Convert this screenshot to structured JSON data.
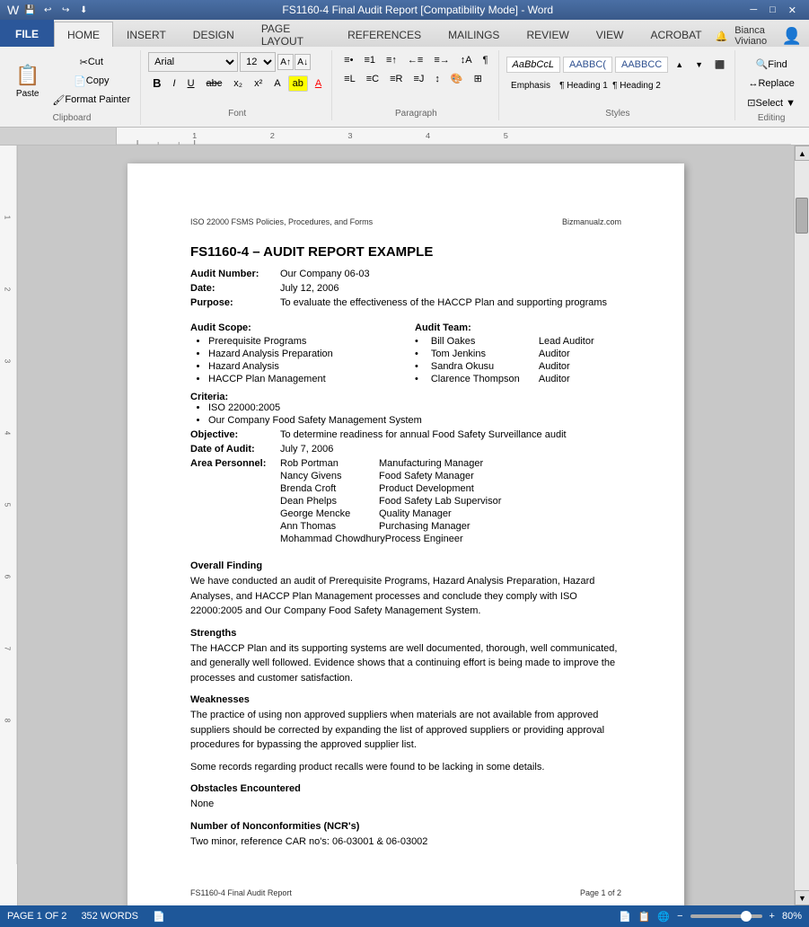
{
  "titleBar": {
    "title": "FS1160-4 Final Audit Report [Compatibility Mode] - Word",
    "minBtn": "─",
    "maxBtn": "□",
    "closeBtn": "✕",
    "quickAccess": [
      "💾",
      "↩",
      "↪",
      "▶",
      "⬇"
    ]
  },
  "ribbon": {
    "tabs": [
      "FILE",
      "HOME",
      "INSERT",
      "DESIGN",
      "PAGE LAYOUT",
      "REFERENCES",
      "MAILINGS",
      "REVIEW",
      "VIEW",
      "ACROBAT"
    ],
    "activeTab": "HOME",
    "fontName": "Arial",
    "fontSize": "12",
    "styles": [
      "Emphasis",
      "¶ Heading 1",
      "¶ Heading 2"
    ],
    "user": "Bianca Viviano",
    "editingGroup": {
      "find": "Find",
      "replace": "Replace",
      "select": "Select ▼"
    }
  },
  "document": {
    "headerLeft": "ISO 22000 FSMS Policies, Procedures, and Forms",
    "headerRight": "Bizmanualz.com",
    "title": "FS1160-4 – AUDIT REPORT EXAMPLE",
    "auditNumber": {
      "label": "Audit Number:",
      "value": "Our Company 06-03"
    },
    "date": {
      "label": "Date:",
      "value": "July 12, 2006"
    },
    "purpose": {
      "label": "Purpose:",
      "value": "To evaluate the effectiveness of the HACCP Plan and supporting programs"
    },
    "auditScope": {
      "label": "Audit Scope:",
      "items": [
        "Prerequisite Programs",
        "Hazard Analysis Preparation",
        "Hazard Analysis",
        "HACCP Plan Management"
      ]
    },
    "auditTeam": {
      "label": "Audit Team:",
      "members": [
        {
          "name": "Bill Oakes",
          "role": "Lead Auditor"
        },
        {
          "name": "Tom Jenkins",
          "role": "Auditor"
        },
        {
          "name": "Sandra Okusu",
          "role": "Auditor"
        },
        {
          "name": "Clarence Thompson",
          "role": "Auditor"
        }
      ]
    },
    "criteria": {
      "label": "Criteria:",
      "items": [
        "ISO 22000:2005",
        "Our Company Food Safety Management System"
      ]
    },
    "objective": {
      "label": "Objective:",
      "value": "To determine readiness for annual Food Safety Surveillance audit"
    },
    "dateOfAudit": {
      "label": "Date of Audit:",
      "value": "July 7, 2006"
    },
    "areaPersonnel": {
      "label": "Area Personnel:",
      "people": [
        {
          "name": "Rob Portman",
          "role": "Manufacturing Manager"
        },
        {
          "name": "Nancy Givens",
          "role": "Food Safety Manager"
        },
        {
          "name": "Brenda Croft",
          "role": "Product Development"
        },
        {
          "name": "Dean Phelps",
          "role": "Food Safety Lab Supervisor"
        },
        {
          "name": "George Mencke",
          "role": "Quality Manager"
        },
        {
          "name": "Ann Thomas",
          "role": "Purchasing Manager"
        },
        {
          "name": "Mohammad Chowdhury",
          "role": "Process Engineer"
        }
      ]
    },
    "overallFinding": {
      "heading": "Overall Finding",
      "text": "We have conducted an audit of Prerequisite Programs, Hazard Analysis Preparation, Hazard Analyses, and HACCP Plan Management processes and conclude they comply with ISO 22000:2005 and Our Company Food Safety Management System."
    },
    "strengths": {
      "heading": "Strengths",
      "text": "The HACCP Plan and its supporting systems are well documented, thorough, well communicated, and generally well followed. Evidence shows that a continuing effort is being made to improve the processes and customer satisfaction."
    },
    "weaknesses": {
      "heading": "Weaknesses",
      "para1": "The practice of using non approved suppliers when materials are not available from approved suppliers should be corrected by expanding the list of approved suppliers or providing approval procedures for bypassing the approved supplier list.",
      "para2": "Some records regarding product recalls were found to be lacking in some details."
    },
    "obstacles": {
      "heading": "Obstacles Encountered",
      "text": "None"
    },
    "ncr": {
      "heading": "Number of Nonconformities (NCR's)",
      "text": "Two minor, reference CAR no's: 06-03001 & 06-03002"
    },
    "footerLeft": "FS1160-4 Final Audit Report",
    "footerRight": "Page 1 of 2"
  },
  "statusBar": {
    "pageInfo": "PAGE 1 OF 2",
    "wordCount": "352 WORDS",
    "zoomLevel": "80%",
    "viewIcons": [
      "📄",
      "📋",
      "📑"
    ]
  }
}
